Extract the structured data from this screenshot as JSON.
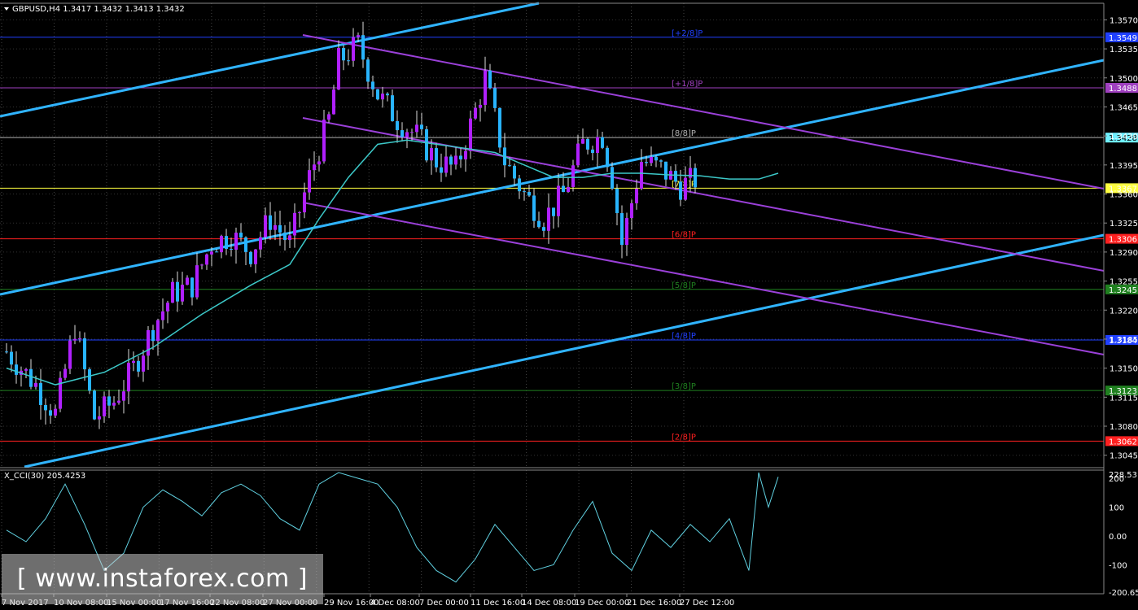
{
  "header": {
    "symbol_line": "GBPUSD,H4  1.3417 1.3432 1.3413 1.3432",
    "cci_line": "X_CCI(30) 205.4253"
  },
  "watermark": {
    "text": "[ www.instaforex.com ]"
  },
  "colors": {
    "bull": "#b020ff",
    "bear": "#28b4ff",
    "ma": "#3cc8c8",
    "channel_up": "#30b4ff",
    "channel_down": "#9a40d8",
    "cci": "#60d0e0",
    "bg": "#000000"
  },
  "chart_data": [
    {
      "type": "candlestick",
      "instrument": "GBPUSD",
      "timeframe": "H4",
      "ohlc_header": {
        "open": 1.3417,
        "high": 1.3432,
        "low": 1.3413,
        "close": 1.3432
      },
      "ylim": [
        1.303,
        1.359
      ],
      "y_ticks": [
        "1.3570",
        "1.3535",
        "1.3500",
        "1.3465",
        "1.3430",
        "1.3395",
        "1.3360",
        "1.3325",
        "1.3290",
        "1.3255",
        "1.3220",
        "1.3185",
        "1.3150",
        "1.3115",
        "1.3080",
        "1.3045"
      ],
      "x_ticks": [
        "7 Nov 2017",
        "10 Nov 08:00",
        "15 Nov 00:00",
        "17 Nov 16:00",
        "22 Nov 08:00",
        "27 Nov 00:00",
        "29 Nov 16:00",
        "4 Dec 08:00",
        "7 Dec 00:00",
        "11 Dec 16:00",
        "14 Dec 08:00",
        "19 Dec 00:00",
        "21 Dec 16:00",
        "27 Dec 12:00"
      ],
      "bars_count": 142,
      "close_path": [
        [
          0,
          1.317
        ],
        [
          6,
          1.313
        ],
        [
          10,
          1.3095
        ],
        [
          14,
          1.32
        ],
        [
          18,
          1.309
        ],
        [
          22,
          1.311
        ],
        [
          26,
          1.315
        ],
        [
          30,
          1.32
        ],
        [
          34,
          1.324
        ],
        [
          38,
          1.325
        ],
        [
          42,
          1.33
        ],
        [
          46,
          1.331
        ],
        [
          50,
          1.329
        ],
        [
          54,
          1.333
        ],
        [
          58,
          1.33
        ],
        [
          62,
          1.338
        ],
        [
          66,
          1.345
        ],
        [
          68,
          1.352
        ],
        [
          72,
          1.354
        ],
        [
          76,
          1.348
        ],
        [
          80,
          1.345
        ],
        [
          84,
          1.343
        ],
        [
          88,
          1.34
        ],
        [
          92,
          1.339
        ],
        [
          96,
          1.346
        ],
        [
          98,
          1.35
        ],
        [
          102,
          1.34
        ],
        [
          106,
          1.336
        ],
        [
          110,
          1.333
        ],
        [
          114,
          1.336
        ],
        [
          118,
          1.342
        ],
        [
          122,
          1.343
        ],
        [
          124,
          1.338
        ],
        [
          126,
          1.33
        ],
        [
          130,
          1.34
        ],
        [
          134,
          1.339
        ],
        [
          138,
          1.337
        ],
        [
          142,
          1.338
        ],
        [
          146,
          1.336
        ],
        [
          150,
          1.339
        ],
        [
          154,
          1.338
        ],
        [
          158,
          1.341
        ]
      ],
      "ma_path": [
        [
          0,
          1.315
        ],
        [
          10,
          1.313
        ],
        [
          20,
          1.3145
        ],
        [
          30,
          1.3175
        ],
        [
          40,
          1.3215
        ],
        [
          50,
          1.325
        ],
        [
          58,
          1.3275
        ],
        [
          64,
          1.333
        ],
        [
          70,
          1.338
        ],
        [
          76,
          1.342
        ],
        [
          82,
          1.3425
        ],
        [
          88,
          1.342
        ],
        [
          94,
          1.3415
        ],
        [
          100,
          1.341
        ],
        [
          106,
          1.3395
        ],
        [
          112,
          1.338
        ],
        [
          118,
          1.338
        ],
        [
          124,
          1.3385
        ],
        [
          130,
          1.3385
        ],
        [
          136,
          1.3383
        ],
        [
          142,
          1.3382
        ],
        [
          148,
          1.3378
        ],
        [
          154,
          1.3378
        ],
        [
          158,
          1.3385
        ]
      ],
      "price_levels": [
        {
          "price": 1.3549,
          "tag": "1.3549",
          "label": "[+2/8]P",
          "color": "#2040ff"
        },
        {
          "price": 1.3488,
          "tag": "1.3488",
          "label": "[+1/8]P",
          "color": "#a040c0"
        },
        {
          "price": 1.3428,
          "tag": "1.3428",
          "label": "[8/8]P",
          "color": "#b0b0b0",
          "current": true
        },
        {
          "price": 1.3367,
          "tag": "1.3367",
          "label": "[7/8]P",
          "color": "#ffff40"
        },
        {
          "price": 1.3306,
          "tag": "1.3306",
          "label": "[6/8]P",
          "color": "#ff2020"
        },
        {
          "price": 1.3245,
          "tag": "1.3245",
          "label": "[5/8]P",
          "color": "#208020"
        },
        {
          "price": 1.3184,
          "tag": "1.3184",
          "label": "[4/8]P",
          "color": "#2040ff"
        },
        {
          "price": 1.3123,
          "tag": "1.3123",
          "label": "[3/8]P",
          "color": "#208020"
        },
        {
          "price": 1.3062,
          "tag": "1.3062",
          "label": "[2/8]P",
          "color": "#ff2020"
        }
      ]
    },
    {
      "type": "line",
      "indicator": "X_CCI(30)",
      "last_value": 205.4253,
      "ylim": [
        -200.652,
        228.5317
      ],
      "y_ticks": [
        "228.5317",
        "200",
        "100",
        "0.00",
        "-100",
        "-200.652"
      ],
      "values": [
        [
          0,
          20
        ],
        [
          4,
          -20
        ],
        [
          8,
          60
        ],
        [
          12,
          180
        ],
        [
          16,
          40
        ],
        [
          20,
          -120
        ],
        [
          24,
          -60
        ],
        [
          28,
          100
        ],
        [
          32,
          160
        ],
        [
          36,
          120
        ],
        [
          40,
          70
        ],
        [
          44,
          150
        ],
        [
          48,
          180
        ],
        [
          52,
          140
        ],
        [
          56,
          60
        ],
        [
          60,
          20
        ],
        [
          64,
          180
        ],
        [
          68,
          220
        ],
        [
          72,
          200
        ],
        [
          76,
          180
        ],
        [
          80,
          100
        ],
        [
          84,
          -40
        ],
        [
          88,
          -120
        ],
        [
          92,
          -160
        ],
        [
          96,
          -80
        ],
        [
          100,
          40
        ],
        [
          104,
          -40
        ],
        [
          108,
          -120
        ],
        [
          112,
          -100
        ],
        [
          116,
          20
        ],
        [
          120,
          120
        ],
        [
          124,
          -60
        ],
        [
          128,
          -120
        ],
        [
          132,
          20
        ],
        [
          136,
          -40
        ],
        [
          140,
          40
        ],
        [
          144,
          -20
        ],
        [
          148,
          60
        ],
        [
          152,
          -120
        ],
        [
          154,
          220
        ],
        [
          156,
          100
        ],
        [
          158,
          205
        ]
      ]
    }
  ]
}
